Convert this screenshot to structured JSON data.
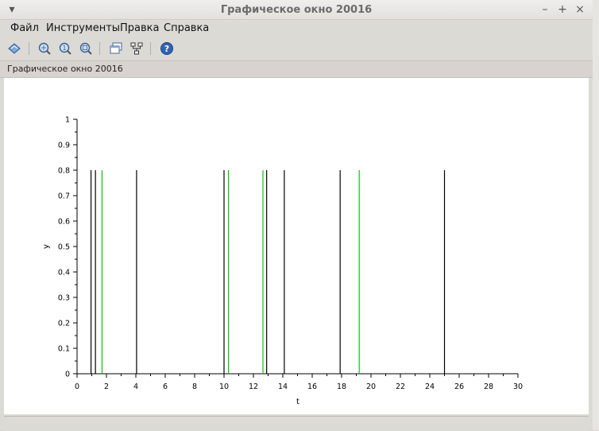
{
  "window": {
    "title": "Графическое окно 20016",
    "controls": [
      "–",
      "+",
      "×"
    ]
  },
  "menu": {
    "items": [
      "Файл",
      "Инструменты",
      "Правка",
      "Справка"
    ]
  },
  "toolbar": {
    "icons": [
      "rotate-icon",
      "zoom-grid-icon",
      "zoom-in-icon",
      "zoom-area-icon",
      "windows-icon",
      "tree-icon",
      "help-icon"
    ]
  },
  "infobar": {
    "text": "Графическое окно 20016"
  },
  "colors": {
    "black_series": "#000000",
    "green_series": "#00cc00"
  },
  "chart_data": {
    "type": "impulse",
    "xlabel": "t",
    "ylabel": "y",
    "xlim": [
      0,
      30
    ],
    "ylim": [
      0,
      1
    ],
    "xticks": [
      "0",
      "2",
      "4",
      "6",
      "8",
      "10",
      "12",
      "14",
      "16",
      "18",
      "20",
      "22",
      "24",
      "26",
      "28",
      "30"
    ],
    "yticks": [
      "0",
      "0.1",
      "0.2",
      "0.3",
      "0.4",
      "0.5",
      "0.6",
      "0.7",
      "0.8",
      "0.9",
      "1"
    ],
    "series": [
      {
        "color": "#000000",
        "x": [
          0.95,
          1.25,
          4.05,
          10.0,
          12.9,
          14.1,
          17.9,
          25.0
        ],
        "y": 0.8
      },
      {
        "color": "#00cc00",
        "x": [
          1.7,
          10.3,
          12.65,
          19.2
        ],
        "y": 0.8
      }
    ]
  }
}
